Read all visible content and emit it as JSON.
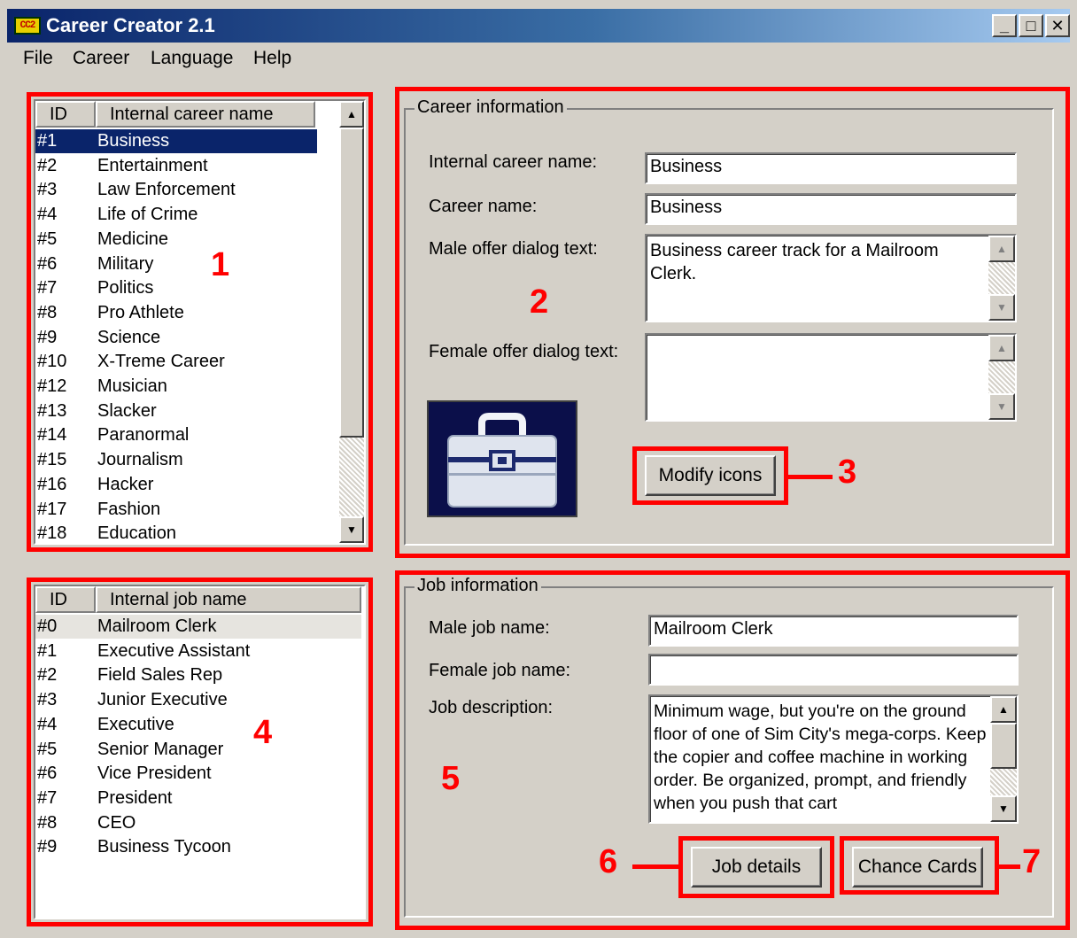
{
  "window": {
    "title": "Career Creator 2.1",
    "app_icon_text": "CC2",
    "controls": {
      "minimize": "_",
      "maximize": "□",
      "close": "✕"
    }
  },
  "menu": [
    "File",
    "Career",
    "Language",
    "Help"
  ],
  "career_list": {
    "headers": [
      "ID",
      "Internal career name"
    ],
    "rows": [
      {
        "id": "#1",
        "name": "Business"
      },
      {
        "id": "#2",
        "name": "Entertainment"
      },
      {
        "id": "#3",
        "name": "Law Enforcement"
      },
      {
        "id": "#4",
        "name": "Life of Crime"
      },
      {
        "id": "#5",
        "name": "Medicine"
      },
      {
        "id": "#6",
        "name": "Military"
      },
      {
        "id": "#7",
        "name": "Politics"
      },
      {
        "id": "#8",
        "name": "Pro Athlete"
      },
      {
        "id": "#9",
        "name": "Science"
      },
      {
        "id": "#10",
        "name": "X-Treme Career"
      },
      {
        "id": "#12",
        "name": "Musician"
      },
      {
        "id": "#13",
        "name": "Slacker"
      },
      {
        "id": "#14",
        "name": "Paranormal"
      },
      {
        "id": "#15",
        "name": "Journalism"
      },
      {
        "id": "#16",
        "name": "Hacker"
      },
      {
        "id": "#17",
        "name": "Fashion"
      },
      {
        "id": "#18",
        "name": "Education"
      }
    ],
    "selected_index": 0
  },
  "career_info": {
    "legend": "Career information",
    "internal_name_label": "Internal career name:",
    "internal_name_value": "Business",
    "career_name_label": "Career name:",
    "career_name_value": "Business",
    "male_offer_label": "Male offer dialog text:",
    "male_offer_value": "Business career track for a Mailroom Clerk.",
    "female_offer_label": "Female offer dialog text:",
    "female_offer_value": "",
    "icon": "briefcase-icon",
    "modify_icons_button": "Modify icons"
  },
  "job_list": {
    "headers": [
      "ID",
      "Internal job name"
    ],
    "rows": [
      {
        "id": "#0",
        "name": "Mailroom Clerk"
      },
      {
        "id": "#1",
        "name": "Executive Assistant"
      },
      {
        "id": "#2",
        "name": "Field Sales Rep"
      },
      {
        "id": "#3",
        "name": "Junior Executive"
      },
      {
        "id": "#4",
        "name": "Executive"
      },
      {
        "id": "#5",
        "name": "Senior Manager"
      },
      {
        "id": "#6",
        "name": "Vice President"
      },
      {
        "id": "#7",
        "name": "President"
      },
      {
        "id": "#8",
        "name": "CEO"
      },
      {
        "id": "#9",
        "name": "Business Tycoon"
      }
    ],
    "selected_index": 0
  },
  "job_info": {
    "legend": "Job information",
    "male_job_label": "Male job name:",
    "male_job_value": "Mailroom Clerk",
    "female_job_label": "Female job name:",
    "female_job_value": "",
    "description_label": "Job description:",
    "description_value": "Minimum wage, but you're on the ground floor of one of Sim City's mega-corps. Keep the copier and coffee machine in working order. Be organized, prompt, and friendly when you push that cart",
    "job_details_button": "Job details",
    "chance_cards_button": "Chance Cards"
  },
  "annotations": [
    "1",
    "2",
    "3",
    "4",
    "5",
    "6",
    "7"
  ],
  "colors": {
    "annotation": "#ff0000",
    "selection": "#0a246a",
    "face": "#d4d0c8",
    "icon_background": "#0b0f4a"
  }
}
